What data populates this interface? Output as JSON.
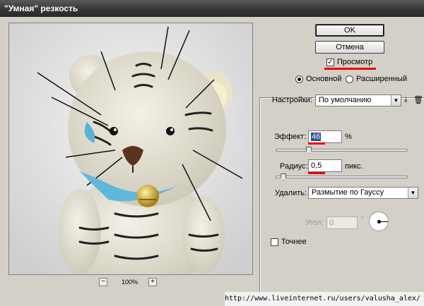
{
  "window": {
    "title": "\"Умная\" резкость"
  },
  "preview": {
    "zoom_label": "100%",
    "zoom_out": "−",
    "zoom_in": "+"
  },
  "buttons": {
    "ok": "OK",
    "cancel": "Отмена"
  },
  "preview_check": {
    "label": "Просмотр",
    "checked": true,
    "mark": "✓"
  },
  "mode": {
    "basic": "Основной",
    "advanced": "Расширенный",
    "selected": "basic"
  },
  "settings": {
    "label": "Настройки:",
    "value": "По умолчанию"
  },
  "effect": {
    "label": "Эффект:",
    "value": "46",
    "unit": "%",
    "slider_fraction": 0.25
  },
  "radius": {
    "label": "Радиус:",
    "value": "0,5",
    "unit": "пикс.",
    "slider_fraction": 0.06
  },
  "remove": {
    "label": "Удалить:",
    "value": "Размытие по Гауссу"
  },
  "angle": {
    "label": "Угол:",
    "value": "0",
    "unit": "°"
  },
  "precise": {
    "label": "Точнее",
    "checked": false
  },
  "watermark": {
    "text": "http://www.liveinternet.ru/users/valusha_alex/"
  },
  "colors": {
    "highlight": "#e00000",
    "titlebar": "#333333"
  }
}
